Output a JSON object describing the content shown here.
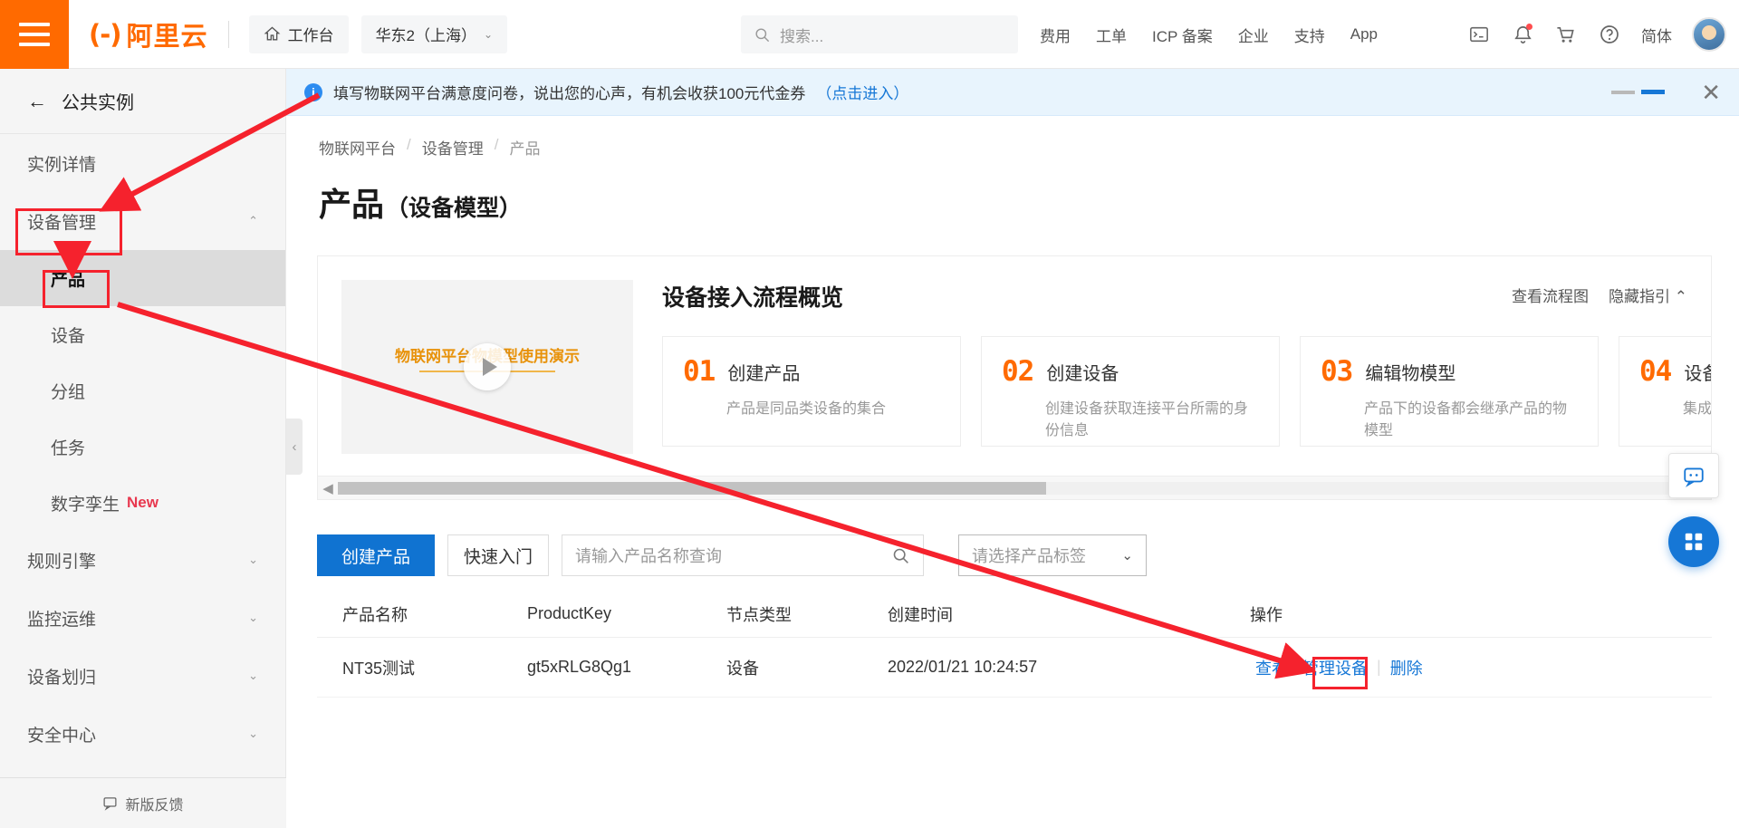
{
  "header": {
    "menu_icon": "hamburger-icon",
    "logo_mark": "(-)",
    "logo_text": "阿里云",
    "workbench": "工作台",
    "workbench_icon": "home-icon",
    "region": "华东2（上海）",
    "search_placeholder": "搜索...",
    "search_icon": "search-icon",
    "nav": [
      "费用",
      "工单",
      "ICP 备案",
      "企业",
      "支持",
      "App"
    ],
    "lang": "简体",
    "icons": [
      "terminal-icon",
      "bell-icon",
      "cart-icon",
      "help-icon"
    ]
  },
  "sidebar": {
    "instance_back_label": "公共实例",
    "items": [
      {
        "label": "实例详情",
        "type": "item",
        "caret": ""
      },
      {
        "label": "设备管理",
        "type": "group",
        "caret": "⌃"
      },
      {
        "label": "产品",
        "type": "sub",
        "active": true
      },
      {
        "label": "设备",
        "type": "sub",
        "active": false
      },
      {
        "label": "分组",
        "type": "sub",
        "active": false
      },
      {
        "label": "任务",
        "type": "sub",
        "active": false
      },
      {
        "label": "数字孪生",
        "type": "sub",
        "active": false,
        "badge": "New"
      },
      {
        "label": "规则引擎",
        "type": "group",
        "caret": "⌄"
      },
      {
        "label": "监控运维",
        "type": "group",
        "caret": "⌄"
      },
      {
        "label": "设备划归",
        "type": "group",
        "caret": "⌄"
      },
      {
        "label": "安全中心",
        "type": "group",
        "caret": "⌄"
      }
    ],
    "footer_label": "新版反馈",
    "footer_icon": "feedback-icon"
  },
  "notice": {
    "icon": "info-icon",
    "text": "填写物联网平台满意度问卷，说出您的心声，有机会收获100元代金券",
    "link": "（点击进入）",
    "close_icon": "close-icon"
  },
  "breadcrumb": [
    "物联网平台",
    "设备管理",
    "产品"
  ],
  "page": {
    "title": "产品",
    "subtitle": "（设备模型）"
  },
  "guide": {
    "video_caption": "物联网平台物模型使用演示",
    "play_icon": "play-icon",
    "title": "设备接入流程概览",
    "actions": [
      "查看流程图",
      "隐藏指引 ⌃"
    ],
    "steps": [
      {
        "num": "01",
        "title": "创建产品",
        "desc": "产品是同品类设备的集合"
      },
      {
        "num": "02",
        "title": "创建设备",
        "desc": "创建设备获取连接平台所需的身份信息"
      },
      {
        "num": "03",
        "title": "编辑物模型",
        "desc": "产品下的设备都会继承产品的物模型"
      },
      {
        "num": "04",
        "title": "设备端",
        "desc": "集成SD序"
      }
    ],
    "scroll_left_icon": "chevron-left-icon",
    "scroll_right_icon": "chevron-right-icon"
  },
  "toolbar": {
    "create_label": "创建产品",
    "quickstart_label": "快速入门",
    "search_placeholder": "请输入产品名称查询",
    "search_icon": "search-icon",
    "tag_placeholder": "请选择产品标签",
    "tag_caret": "⌄"
  },
  "table": {
    "columns": [
      "产品名称",
      "ProductKey",
      "节点类型",
      "创建时间",
      "操作"
    ],
    "rows": [
      {
        "name": "NT35测试",
        "product_key": "gt5xRLG8Qg1",
        "node_type": "设备",
        "created": "2022/01/21 10:24:57",
        "actions": [
          "查看",
          "管理设备",
          "删除"
        ]
      }
    ]
  },
  "floating": {
    "chat_icon": "chat-icon",
    "grid_icon": "grid-icon",
    "collapse_icon": "chevron-left-icon"
  },
  "colors": {
    "brand_orange": "#ff6a00",
    "link_blue": "#1677d6",
    "primary_button": "#1073d1",
    "annotation_red": "#f5222d",
    "badge_red": "#e8384f"
  }
}
